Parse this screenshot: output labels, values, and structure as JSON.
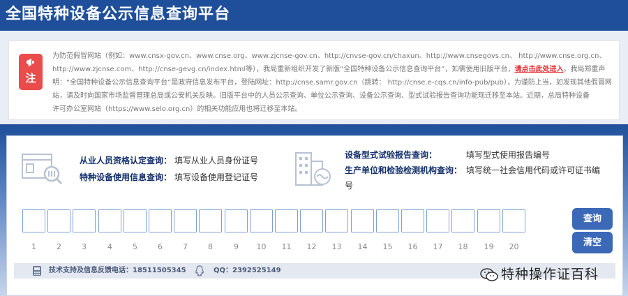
{
  "header": {
    "title": "全国特种设备公示信息查询平台"
  },
  "notice": {
    "badge_label": "注",
    "line1": "为防范假冒网站（例如：www.cnsx-gov.cn、www.cnse.org、www.zjcnse-gov.cn、http://cnvse-gov.cn/chaxun、http://www.cnsegovs.cn、 http://www.cnse.org.cn、",
    "line2_before": "http://www.zjcnse.com、http://cnse-gevg.cn/index.html等），我局重新组织开发了新版“全国特种设备公示信息查询平台”，如需使用旧版平台，",
    "old_link": "请点击此处进入",
    "line2_after": "。我局郑重声",
    "line3": "明：“全国特种设备公示信息查询平台”是政府信息发布平台，登陆网址：http://cnse.samr.gov.cn（跳转： http://cnse.e-cqs.cn/info-pub/pub），为谨防上当，如发现其他假冒网",
    "line4": "站，请及时向国家市场监督管理总局或公安机关反映。旧版平台中的人员公示查询、单位公示查询、设备公示查询、型式试验报告查询功能现迁移至本站。近期，总局特种设备",
    "line5": "许可办公室网站（https://www.selo.org.cn）的相关功能应用也将迁移至本站。"
  },
  "queries": [
    {
      "label": "从业人员资格认定查询：",
      "hint": "填写从业人员身份证号"
    },
    {
      "label": "特种设备使用信息查询：",
      "hint": "填写设备使用登记证号"
    },
    {
      "label": "设备型式试验报告查询：",
      "hint": "填写型式使用报告编号"
    },
    {
      "label": "生产单位和检验检测机构查询：",
      "hint": "填写统一社会信用代码或许可证书编",
      "hint_wrap": "号"
    }
  ],
  "digits": [
    "1",
    "2",
    "3",
    "4",
    "5",
    "6",
    "7",
    "8",
    "9",
    "10",
    "11",
    "12",
    "13",
    "14",
    "15",
    "16",
    "17",
    "18",
    "19",
    "20"
  ],
  "buttons": {
    "search": "查询",
    "clear": "清空"
  },
  "footer": {
    "support_label": "技术支持及信息反馈电话：18511505345",
    "qq_label": "QQ：2392525149"
  },
  "watermark": {
    "text": "特种操作证百科"
  },
  "icons": {
    "badge": "megaphone-icon",
    "personnel": "id-card-search-icon",
    "building": "building-icon",
    "phone": "phone-icon",
    "qq": "qq-icon",
    "wechat": "wechat-icon"
  },
  "colors": {
    "header": "#1f4f9a",
    "accent": "#3b69b7",
    "notice_badge": "#ea4b4b",
    "link": "#e5252a"
  }
}
